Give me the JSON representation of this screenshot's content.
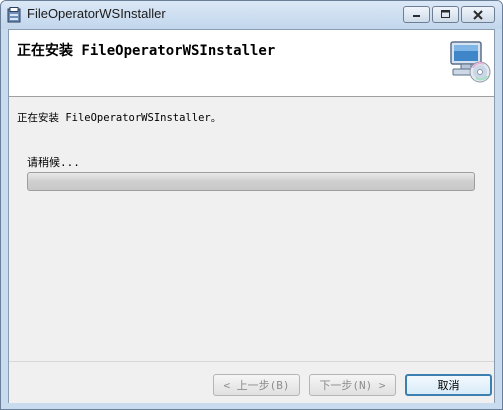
{
  "window": {
    "title": "FileOperatorWSInstaller",
    "controls": {
      "minimize": "minimize-icon",
      "maximize": "maximize-icon",
      "close": "close-icon"
    }
  },
  "header": {
    "title": "正在安装 FileOperatorWSInstaller",
    "icon": "computer-cd-icon"
  },
  "main": {
    "message": "正在安装 FileOperatorWSInstaller。",
    "wait_label": "请稍候...",
    "progress_fraction": 0.0
  },
  "footer": {
    "back_label": "< 上一步(B)",
    "next_label": "下一步(N) >",
    "cancel_label": "取消"
  }
}
